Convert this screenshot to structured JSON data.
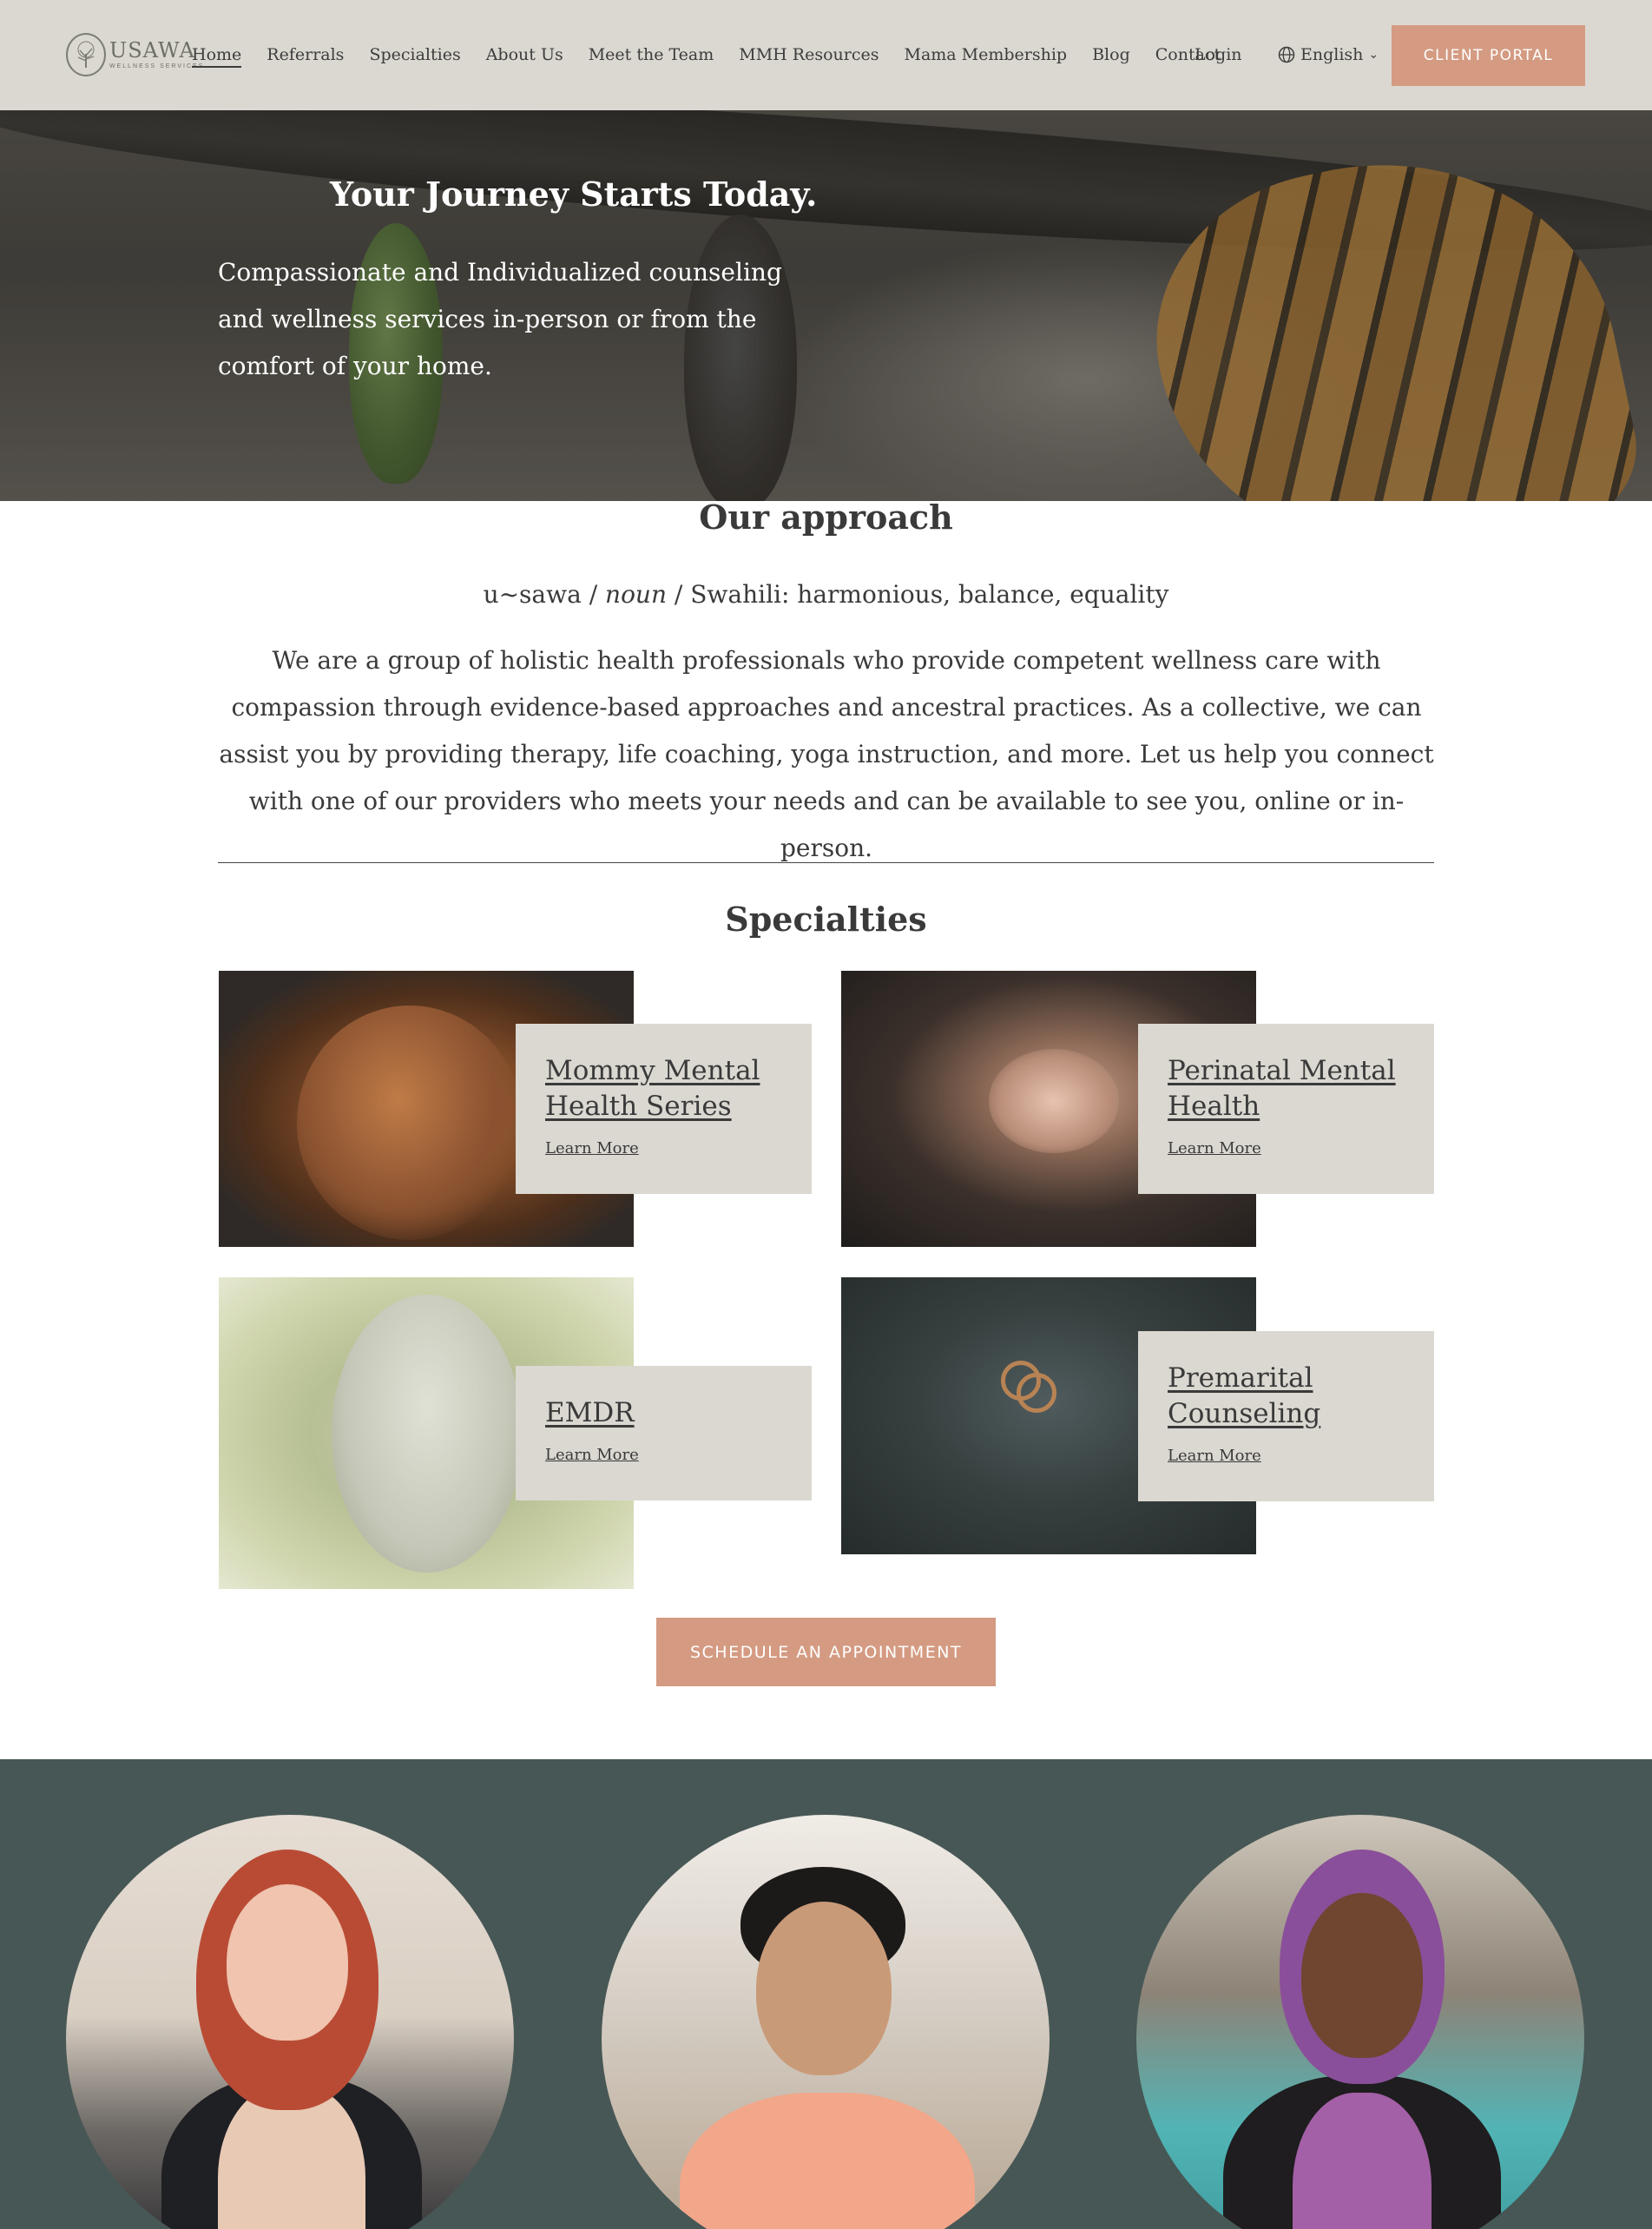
{
  "header": {
    "logo": {
      "name": "USAWA",
      "tagline": "WELLNESS SERVICES"
    },
    "nav": [
      "Home",
      "Referrals",
      "Specialties",
      "About Us",
      "Meet the Team",
      "MMH Resources",
      "Mama Membership",
      "Blog",
      "Contact"
    ],
    "active_nav": "Home",
    "login_label": "Login",
    "language_label": "English",
    "portal_button": "CLIENT PORTAL"
  },
  "hero": {
    "title": "Your Journey Starts Today.",
    "subtitle": "Compassionate and Individualized counseling and wellness services in-person or from the comfort of your home."
  },
  "approach": {
    "heading": "Our approach",
    "definition_word": "u~sawa",
    "definition_pos": "noun",
    "definition_meaning": "Swahili: harmonious, balance, equality",
    "paragraph": "We are a group of holistic health professionals who provide competent wellness care with compassion through evidence-based approaches and ancestral practices.  As a collective, we can assist you by providing therapy, life coaching, yoga instruction, and more. Let us help you connect with one of our providers who meets your needs and can be available to see you, online or in-person."
  },
  "specialties": {
    "heading": "Specialties",
    "items": [
      {
        "title": "Mommy Mental Health Series",
        "link": "Learn More"
      },
      {
        "title": "Perinatal Mental Health",
        "link": "Learn More"
      },
      {
        "title": "EMDR",
        "link": "Learn More"
      },
      {
        "title": "Premarital Counseling",
        "link": "Learn More"
      }
    ],
    "cta": "SCHEDULE AN APPOINTMENT"
  },
  "colors": {
    "header_bg": "#dbd8d1",
    "accent": "#d49b82",
    "team_bg": "#475755",
    "text": "#3a3a3a"
  },
  "icons": [
    "globe-icon",
    "chevron-down-icon",
    "logo-tree-icon"
  ]
}
